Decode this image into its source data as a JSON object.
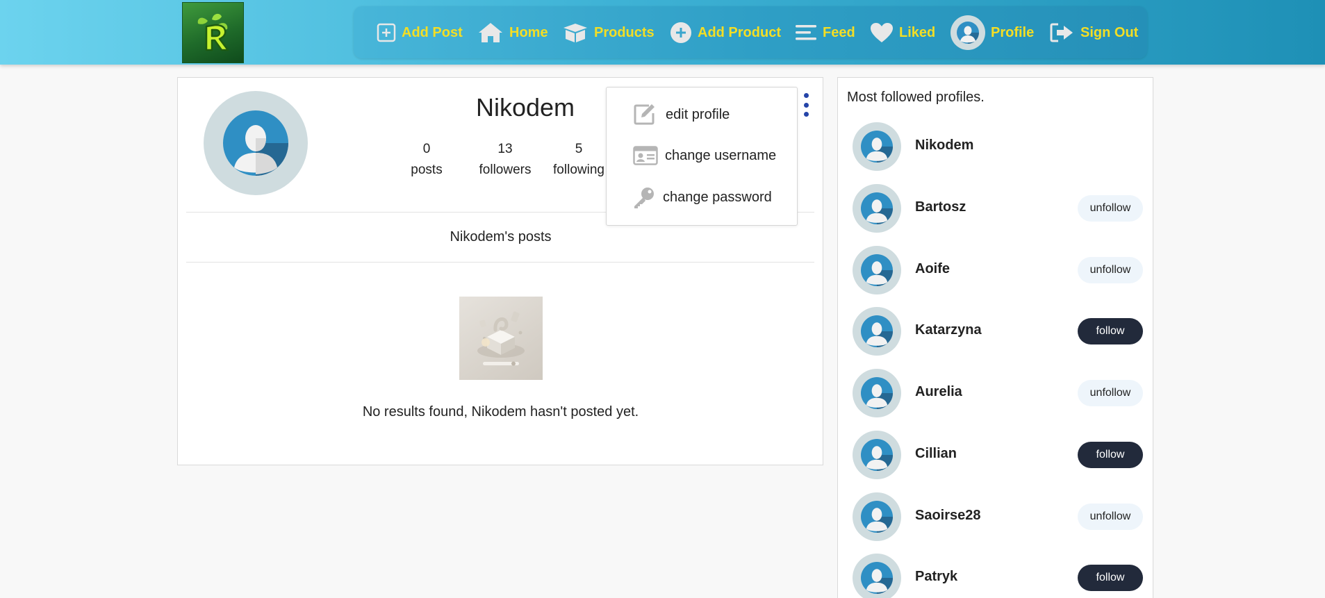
{
  "nav": {
    "items": [
      {
        "label": "Add Post",
        "icon": "plus-square-icon"
      },
      {
        "label": "Home",
        "icon": "home-icon"
      },
      {
        "label": "Products",
        "icon": "box-icon"
      },
      {
        "label": "Add Product",
        "icon": "plus-circle-icon"
      },
      {
        "label": "Feed",
        "icon": "menu-lines-icon"
      },
      {
        "label": "Liked",
        "icon": "heart-icon"
      },
      {
        "label": "Profile",
        "icon": "avatar-icon"
      },
      {
        "label": "Sign Out",
        "icon": "sign-out-icon"
      }
    ],
    "text_color": "#f4de24"
  },
  "profile": {
    "username": "Nikodem",
    "stats": [
      {
        "value": "0",
        "label": "posts"
      },
      {
        "value": "13",
        "label": "followers"
      },
      {
        "value": "5",
        "label": "following"
      }
    ],
    "posts_title": "Nikodem's posts",
    "empty_message": "No results found, Nikodem hasn't posted yet."
  },
  "menu": {
    "items": [
      {
        "label": "edit profile",
        "icon": "edit-icon"
      },
      {
        "label": "change username",
        "icon": "id-card-icon"
      },
      {
        "label": "change password",
        "icon": "key-icon"
      }
    ]
  },
  "side": {
    "title": "Most followed profiles.",
    "profiles": [
      {
        "name": "Nikodem",
        "button": ""
      },
      {
        "name": "Bartosz",
        "button": "unfollow"
      },
      {
        "name": "Aoife",
        "button": "unfollow"
      },
      {
        "name": "Katarzyna",
        "button": "follow"
      },
      {
        "name": "Aurelia",
        "button": "unfollow"
      },
      {
        "name": "Cillian",
        "button": "follow"
      },
      {
        "name": "Saoirse28",
        "button": "unfollow"
      },
      {
        "name": "Patryk",
        "button": "follow"
      }
    ]
  }
}
